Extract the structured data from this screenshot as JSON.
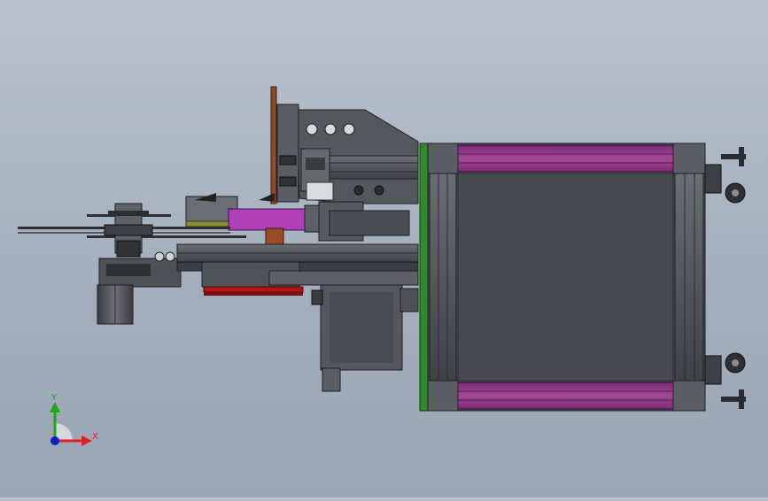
{
  "triad": {
    "x_label": "X",
    "y_label": "Y",
    "colors": {
      "x": "#e02020",
      "y": "#1fa51f",
      "z": "#1020c0"
    }
  },
  "palette": {
    "steel": "#4d5055",
    "steel_dark": "#2e3034",
    "frame_purple": "#9b3a8c",
    "cylinder_purple": "#b040b8",
    "green_plate": "#2f8a2a",
    "copper": "#9a4a24",
    "red_bar": "#b01818",
    "olive": "#8a8a34"
  }
}
